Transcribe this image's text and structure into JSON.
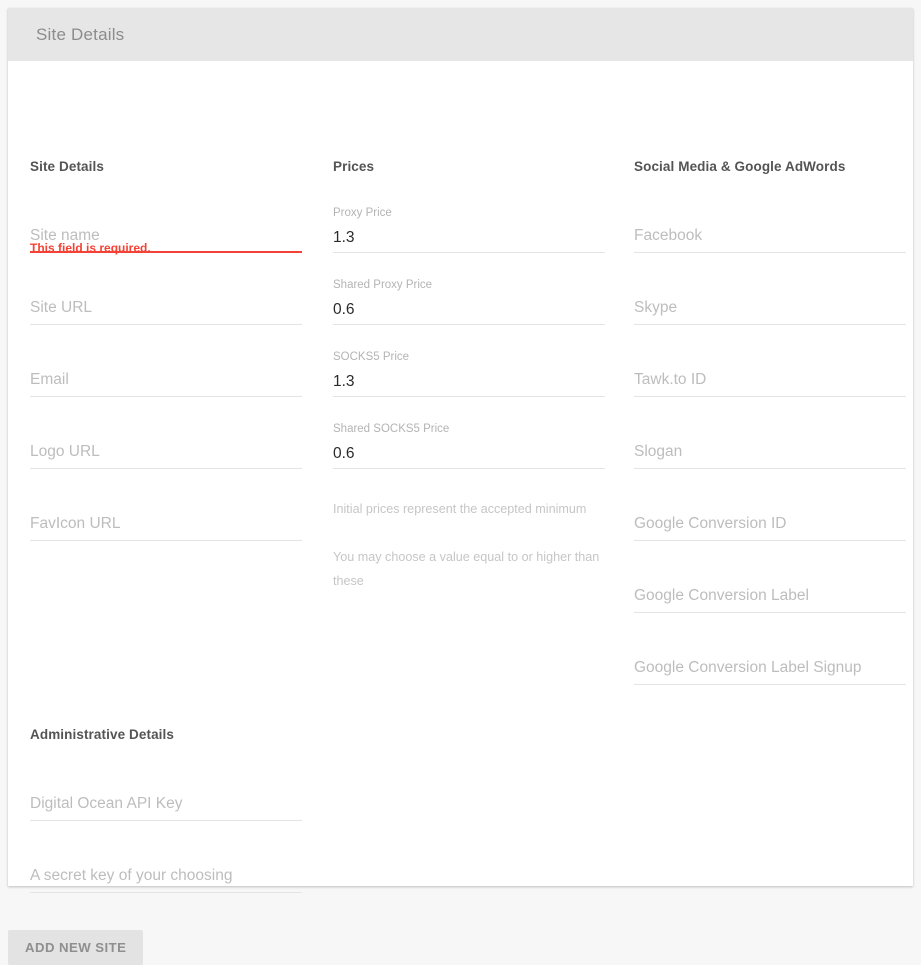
{
  "header": {
    "title": "Site Details"
  },
  "columns": {
    "site_details": {
      "title": "Site Details",
      "fields": [
        {
          "placeholder": "Site name",
          "value": "",
          "error": "This field is required."
        },
        {
          "placeholder": "Site URL",
          "value": ""
        },
        {
          "placeholder": "Email",
          "value": ""
        },
        {
          "placeholder": "Logo URL",
          "value": ""
        },
        {
          "placeholder": "FavIcon URL",
          "value": ""
        }
      ]
    },
    "administrative_details": {
      "title": "Administrative Details",
      "fields": [
        {
          "placeholder": "Digital Ocean API Key",
          "value": ""
        },
        {
          "placeholder": "A secret key of your choosing",
          "value": ""
        }
      ]
    },
    "prices": {
      "title": "Prices",
      "fields": [
        {
          "label": "Proxy Price",
          "value": "1.3"
        },
        {
          "label": "Shared Proxy Price",
          "value": "0.6"
        },
        {
          "label": "SOCKS5 Price",
          "value": "1.3"
        },
        {
          "label": "Shared SOCKS5 Price",
          "value": "0.6"
        }
      ],
      "helper_line_1": "Initial prices represent the accepted minimum",
      "helper_line_2": "You may choose a value equal to or higher than these"
    },
    "social_media": {
      "title": "Social Media & Google AdWords",
      "fields": [
        {
          "placeholder": "Facebook",
          "value": ""
        },
        {
          "placeholder": "Skype",
          "value": ""
        },
        {
          "placeholder": "Tawk.to ID",
          "value": ""
        },
        {
          "placeholder": "Slogan",
          "value": ""
        },
        {
          "placeholder": "Google Conversion ID",
          "value": ""
        },
        {
          "placeholder": "Google Conversion Label",
          "value": ""
        },
        {
          "placeholder": "Google Conversion Label Signup",
          "value": ""
        }
      ]
    }
  },
  "footer": {
    "submit_label": "ADD NEW SITE"
  },
  "colors": {
    "error": "#f44336",
    "header_bg": "#e6e6e6",
    "page_bg": "#f7f7f7",
    "underline": "#e4e4e4"
  }
}
